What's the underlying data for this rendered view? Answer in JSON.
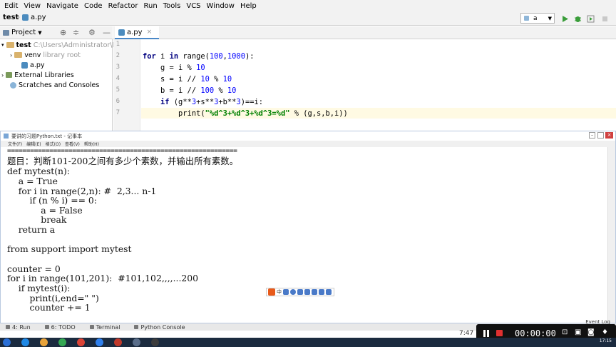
{
  "ide": {
    "menu": [
      "Edit",
      "View",
      "Navigate",
      "Code",
      "Refactor",
      "Run",
      "Tools",
      "VCS",
      "Window",
      "Help"
    ],
    "breadcrumb": {
      "project": "test",
      "file": "a.py"
    },
    "run_config": "a",
    "project_panel": {
      "title": "Project",
      "tree": [
        {
          "label": "test",
          "hint": "C:\\Users\\Administrator\\Pyc",
          "bold": true
        },
        {
          "label": "venv",
          "hint": "library root"
        },
        {
          "label": "a.py",
          "hint": ""
        },
        {
          "label": "External Libraries",
          "hint": ""
        },
        {
          "label": "Scratches and Consoles",
          "hint": ""
        }
      ]
    },
    "editor_tab": "a.py",
    "line_numbers": [
      "1",
      "2",
      "3",
      "4",
      "5",
      "6",
      "7"
    ],
    "code_lines": [
      "",
      "for i in range(100,1000):",
      "    g = i % 10",
      "    s = i // 10 % 10",
      "    b = i // 100 % 10",
      "    if (g**3+s**3+b**3)==i:",
      "        print(\"%d^3+%d^3+%d^3=%d\" % (g,s,b,i))"
    ],
    "tool_tabs": [
      "4: Run",
      "6: TODO",
      "Terminal",
      "Python Console"
    ],
    "status_right": "Event Log",
    "time_left": "7:47"
  },
  "notepad": {
    "title": "要讲的习题Python.txt - 记事本",
    "menu": [
      "文件(F)",
      "编辑(E)",
      "格式(O)",
      "查看(V)",
      "帮助(H)"
    ],
    "lines": [
      "============================================================",
      "题目：判断101-200之间有多少个素数，并输出所有素数。",
      "def mytest(n):",
      "    a = True",
      "    for i in range(2,n): #  2,3... n-1",
      "        if (n % i) == 0:",
      "            a = False",
      "            break",
      "    return a",
      "",
      "from support import mytest",
      "",
      "counter = 0",
      "for i in range(101,201):  #101,102,,,,...200",
      "    if mytest(i):",
      "        print(i,end=\" \")",
      "        counter += 1"
    ],
    "ime_label": "中"
  },
  "recorder": {
    "time": "00:00:00"
  },
  "taskbar": {
    "clock": "17:15"
  },
  "colors": {
    "keyword": "#000080",
    "number": "#0000ff",
    "string": "#008000",
    "caret_line": "#fffae3",
    "recorder_bg": "#111111",
    "taskbar_bg": "#1b2b3f"
  }
}
